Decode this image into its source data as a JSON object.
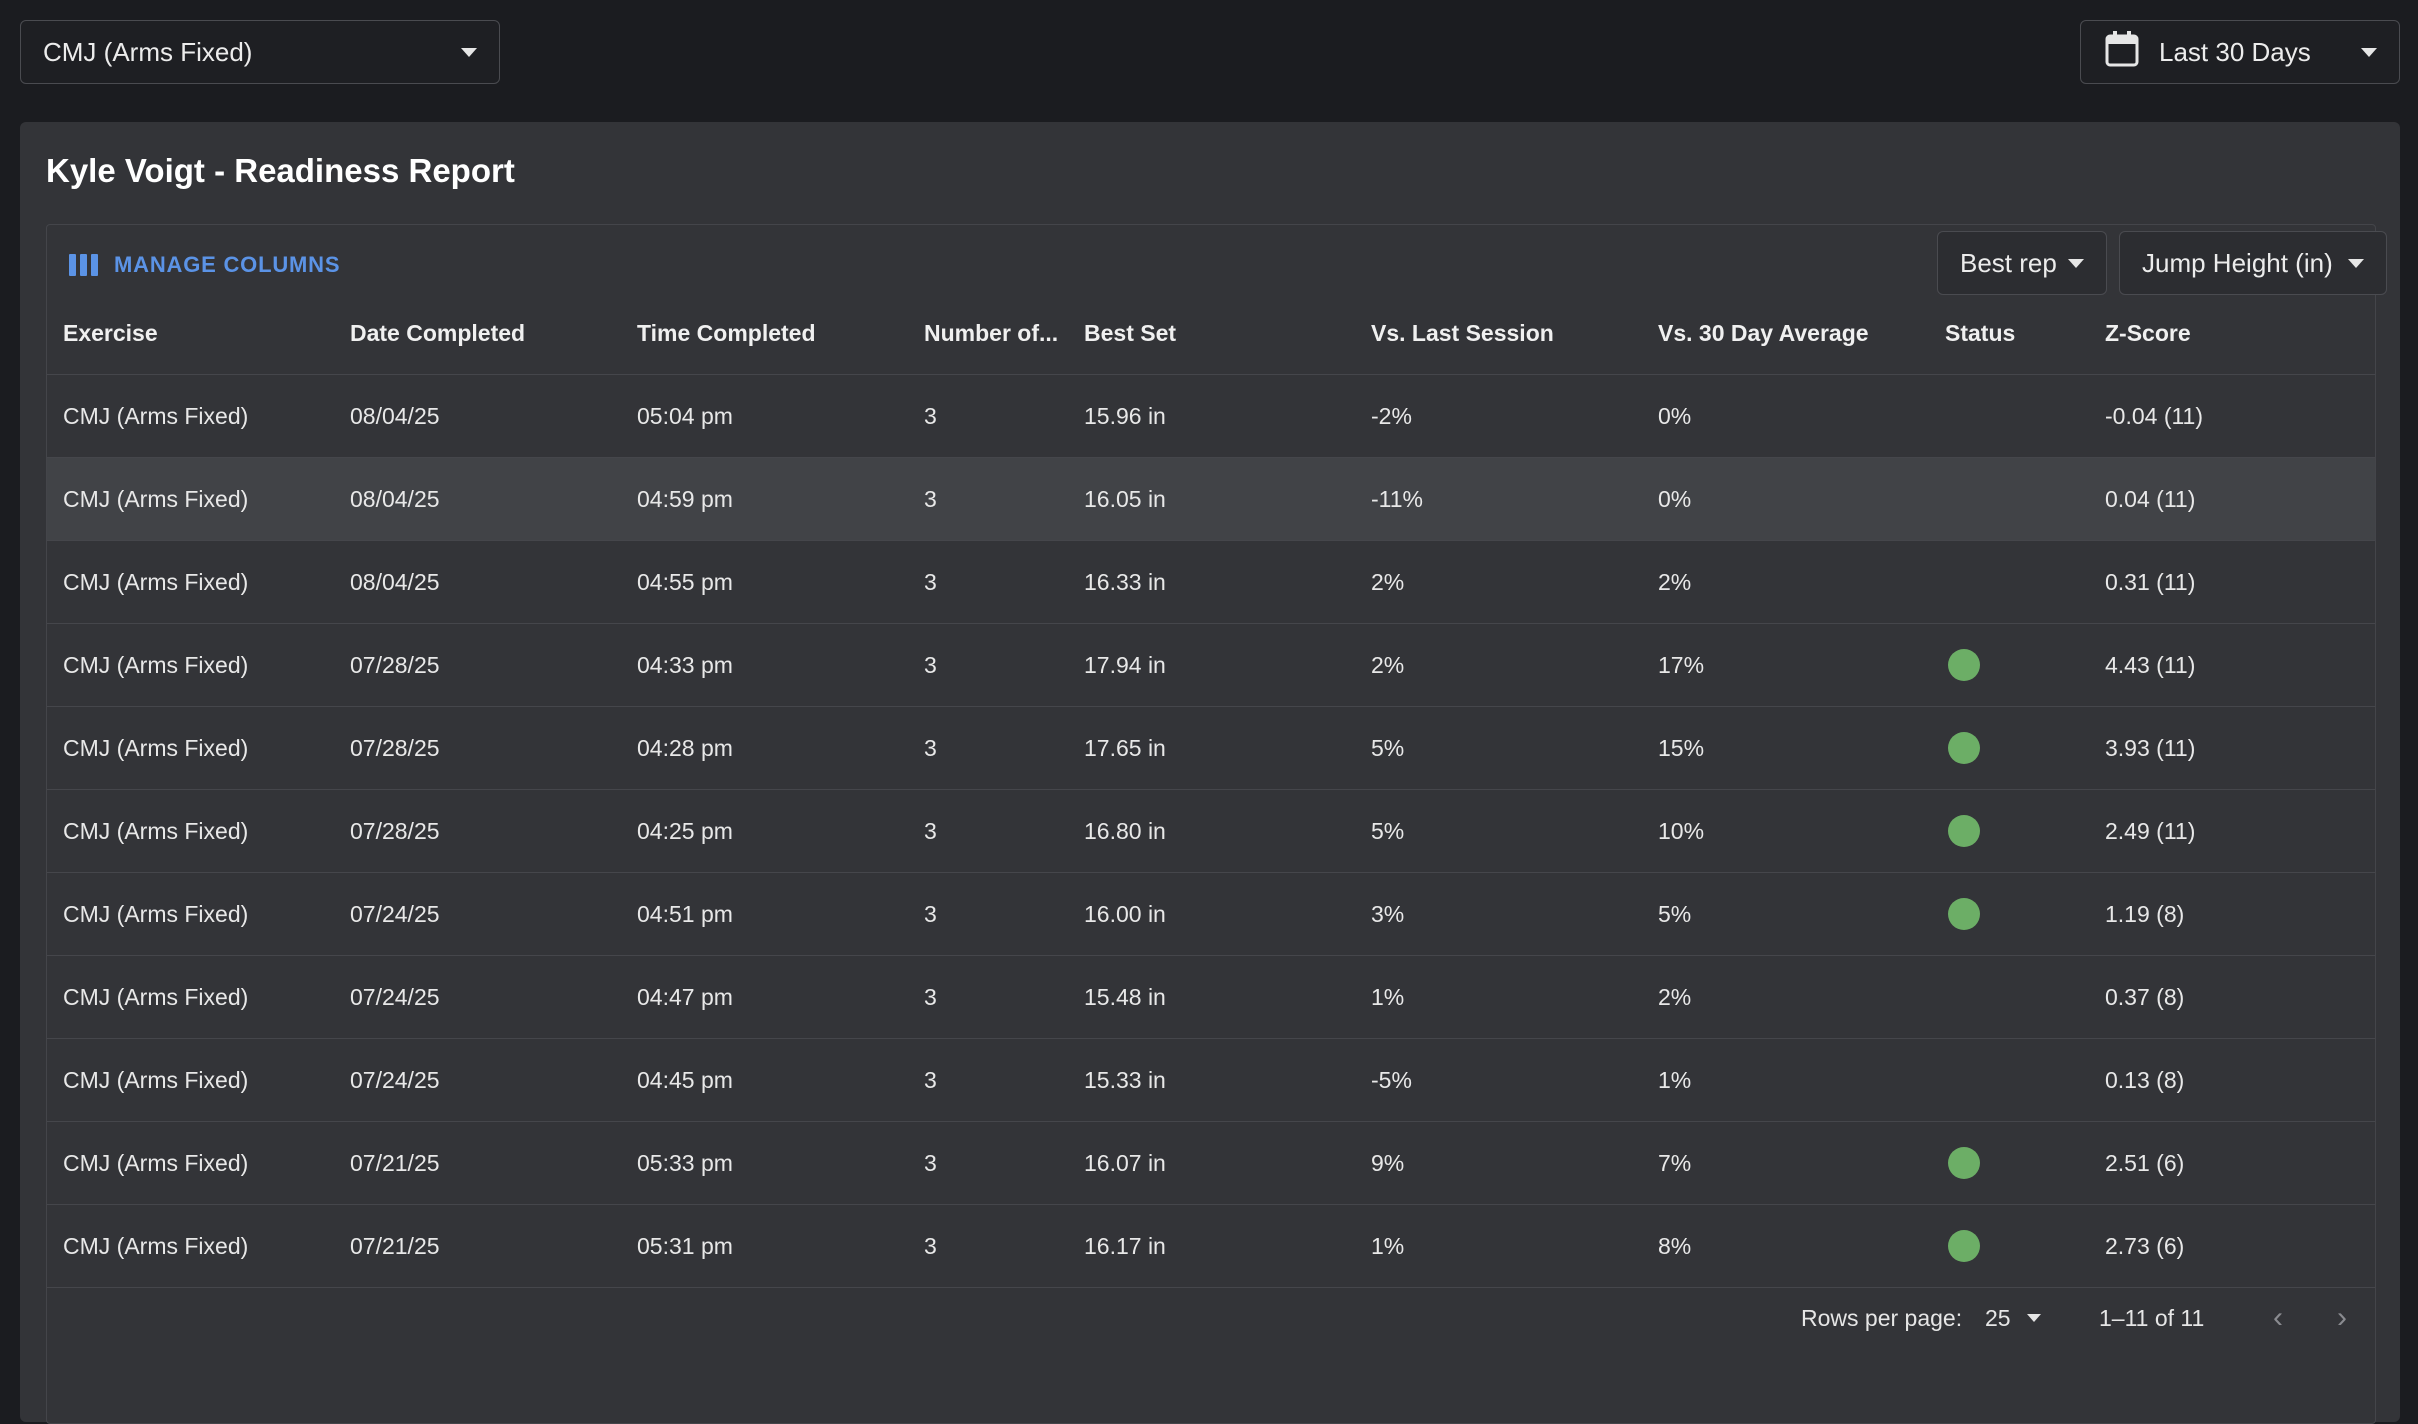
{
  "filters": {
    "exercise": "CMJ (Arms Fixed)",
    "date_range": "Last 30 Days"
  },
  "report": {
    "title": "Kyle Voigt - Readiness Report",
    "manage_columns": "MANAGE COLUMNS",
    "rep_mode": "Best rep",
    "metric": "Jump Height (in)"
  },
  "table": {
    "headers": [
      "Exercise",
      "Date Completed",
      "Time Completed",
      "Number of...",
      "Best Set",
      "Vs. Last Session",
      "Vs. 30 Day Average",
      "Status",
      "Z-Score"
    ],
    "rows": [
      {
        "exercise": "CMJ (Arms Fixed)",
        "date": "08/04/25",
        "time": "05:04 pm",
        "num": "3",
        "best": "15.96 in",
        "vs_last": "-2%",
        "vs_avg": "0%",
        "status": "",
        "z": "-0.04 (11)"
      },
      {
        "exercise": "CMJ (Arms Fixed)",
        "date": "08/04/25",
        "time": "04:59 pm",
        "num": "3",
        "best": "16.05 in",
        "vs_last": "-11%",
        "vs_avg": "0%",
        "status": "",
        "z": "0.04 (11)"
      },
      {
        "exercise": "CMJ (Arms Fixed)",
        "date": "08/04/25",
        "time": "04:55 pm",
        "num": "3",
        "best": "16.33 in",
        "vs_last": "2%",
        "vs_avg": "2%",
        "status": "",
        "z": "0.31 (11)"
      },
      {
        "exercise": "CMJ (Arms Fixed)",
        "date": "07/28/25",
        "time": "04:33 pm",
        "num": "3",
        "best": "17.94 in",
        "vs_last": "2%",
        "vs_avg": "17%",
        "status": "green",
        "z": "4.43 (11)"
      },
      {
        "exercise": "CMJ (Arms Fixed)",
        "date": "07/28/25",
        "time": "04:28 pm",
        "num": "3",
        "best": "17.65 in",
        "vs_last": "5%",
        "vs_avg": "15%",
        "status": "green",
        "z": "3.93 (11)"
      },
      {
        "exercise": "CMJ (Arms Fixed)",
        "date": "07/28/25",
        "time": "04:25 pm",
        "num": "3",
        "best": "16.80 in",
        "vs_last": "5%",
        "vs_avg": "10%",
        "status": "green",
        "z": "2.49 (11)"
      },
      {
        "exercise": "CMJ (Arms Fixed)",
        "date": "07/24/25",
        "time": "04:51 pm",
        "num": "3",
        "best": "16.00 in",
        "vs_last": "3%",
        "vs_avg": "5%",
        "status": "green",
        "z": "1.19 (8)"
      },
      {
        "exercise": "CMJ (Arms Fixed)",
        "date": "07/24/25",
        "time": "04:47 pm",
        "num": "3",
        "best": "15.48 in",
        "vs_last": "1%",
        "vs_avg": "2%",
        "status": "",
        "z": "0.37 (8)"
      },
      {
        "exercise": "CMJ (Arms Fixed)",
        "date": "07/24/25",
        "time": "04:45 pm",
        "num": "3",
        "best": "15.33 in",
        "vs_last": "-5%",
        "vs_avg": "1%",
        "status": "",
        "z": "0.13 (8)"
      },
      {
        "exercise": "CMJ (Arms Fixed)",
        "date": "07/21/25",
        "time": "05:33 pm",
        "num": "3",
        "best": "16.07 in",
        "vs_last": "9%",
        "vs_avg": "7%",
        "status": "green",
        "z": "2.51 (6)"
      },
      {
        "exercise": "CMJ (Arms Fixed)",
        "date": "07/21/25",
        "time": "05:31 pm",
        "num": "3",
        "best": "16.17 in",
        "vs_last": "1%",
        "vs_avg": "8%",
        "status": "green",
        "z": "2.73 (6)"
      }
    ],
    "highlighted_row": 1
  },
  "pagination": {
    "rows_per_page_label": "Rows per page:",
    "rows_per_page": "25",
    "range": "1–11 of 11",
    "prev": "‹",
    "next": "›"
  },
  "colors": {
    "accent": "#5b93e6",
    "status_green": "#6cae66"
  }
}
